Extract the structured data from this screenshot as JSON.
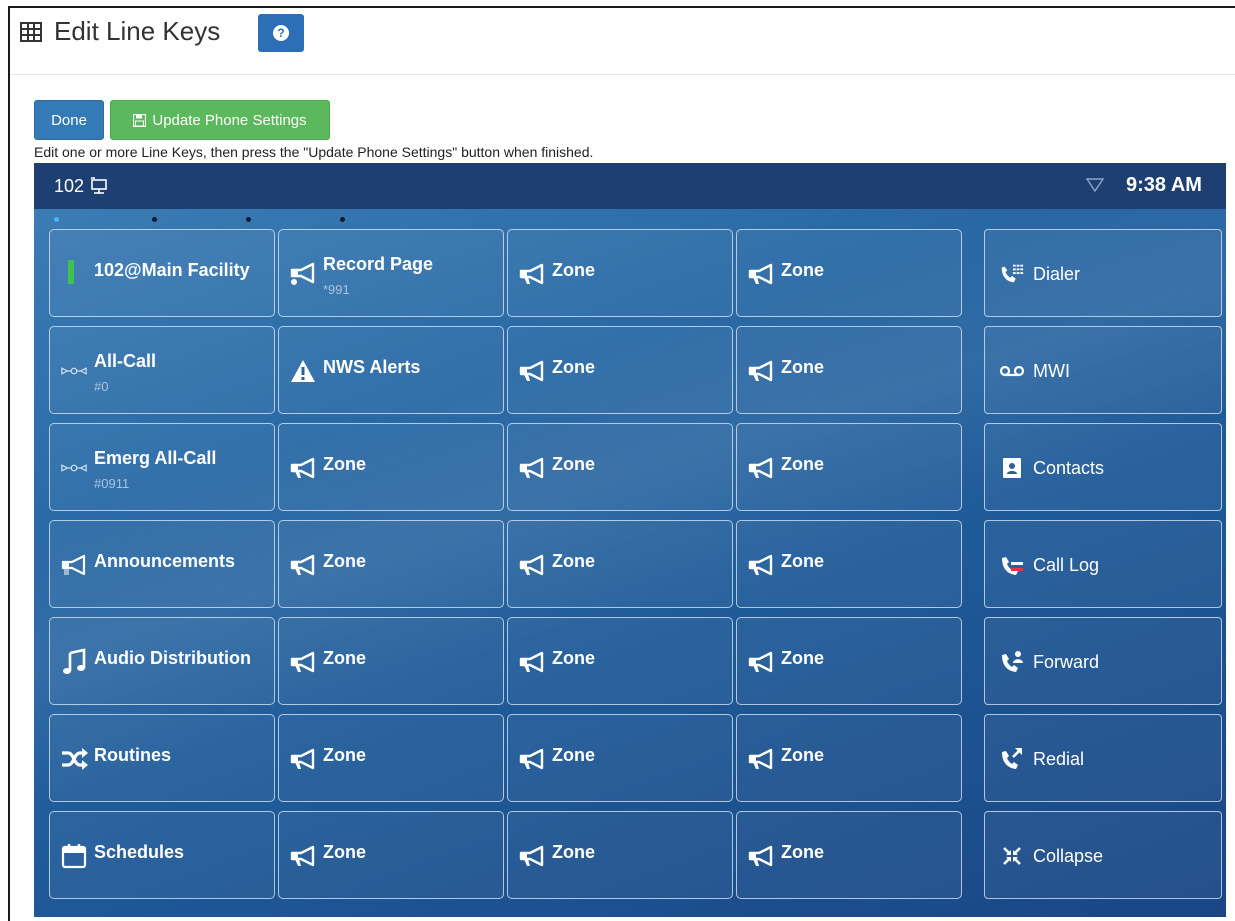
{
  "header": {
    "title": "Edit Line Keys",
    "help_label": "?"
  },
  "toolbar": {
    "done_label": "Done",
    "update_label": "Update Phone Settings"
  },
  "help_text": "Edit one or more Line Keys, then press the \"Update Phone Settings\" button when finished.",
  "phone": {
    "extension": "102",
    "time": "9:38 AM",
    "rows": [
      [
        {
          "label": "102@Main Facility",
          "sub": "",
          "icon": "green-line-indicator"
        },
        {
          "label": "Record Page",
          "sub": "*991",
          "icon": "megaphone-record-icon"
        },
        {
          "label": "Zone",
          "sub": "",
          "icon": "megaphone-icon"
        },
        {
          "label": "Zone",
          "sub": "",
          "icon": "megaphone-icon"
        }
      ],
      [
        {
          "label": "All-Call",
          "sub": "#0",
          "icon": "all-call-icon"
        },
        {
          "label": "NWS Alerts",
          "sub": "",
          "icon": "warning-icon"
        },
        {
          "label": "Zone",
          "sub": "",
          "icon": "megaphone-icon"
        },
        {
          "label": "Zone",
          "sub": "",
          "icon": "megaphone-icon"
        }
      ],
      [
        {
          "label": "Emerg All-Call",
          "sub": "#0911",
          "icon": "all-call-icon"
        },
        {
          "label": "Zone",
          "sub": "",
          "icon": "megaphone-icon"
        },
        {
          "label": "Zone",
          "sub": "",
          "icon": "megaphone-icon"
        },
        {
          "label": "Zone",
          "sub": "",
          "icon": "megaphone-icon"
        }
      ],
      [
        {
          "label": "Announcements",
          "sub": "",
          "icon": "announcement-icon"
        },
        {
          "label": "Zone",
          "sub": "",
          "icon": "megaphone-icon"
        },
        {
          "label": "Zone",
          "sub": "",
          "icon": "megaphone-icon"
        },
        {
          "label": "Zone",
          "sub": "",
          "icon": "megaphone-icon"
        }
      ],
      [
        {
          "label": "Audio Distribution",
          "sub": "",
          "icon": "music-note-icon"
        },
        {
          "label": "Zone",
          "sub": "",
          "icon": "megaphone-icon"
        },
        {
          "label": "Zone",
          "sub": "",
          "icon": "megaphone-icon"
        },
        {
          "label": "Zone",
          "sub": "",
          "icon": "megaphone-icon"
        }
      ],
      [
        {
          "label": "Routines",
          "sub": "",
          "icon": "shuffle-icon"
        },
        {
          "label": "Zone",
          "sub": "",
          "icon": "megaphone-icon"
        },
        {
          "label": "Zone",
          "sub": "",
          "icon": "megaphone-icon"
        },
        {
          "label": "Zone",
          "sub": "",
          "icon": "megaphone-icon"
        }
      ],
      [
        {
          "label": "Schedules",
          "sub": "",
          "icon": "calendar-icon"
        },
        {
          "label": "Zone",
          "sub": "",
          "icon": "megaphone-icon"
        },
        {
          "label": "Zone",
          "sub": "",
          "icon": "megaphone-icon"
        },
        {
          "label": "Zone",
          "sub": "",
          "icon": "megaphone-icon"
        }
      ]
    ],
    "softkeys": [
      {
        "label": "Dialer",
        "icon": "dialer-icon"
      },
      {
        "label": "MWI",
        "icon": "voicemail-icon"
      },
      {
        "label": "Contacts",
        "icon": "contacts-icon"
      },
      {
        "label": "Call Log",
        "icon": "call-log-icon"
      },
      {
        "label": "Forward",
        "icon": "forward-icon"
      },
      {
        "label": "Redial",
        "icon": "redial-icon"
      },
      {
        "label": "Collapse",
        "icon": "collapse-icon"
      }
    ]
  }
}
